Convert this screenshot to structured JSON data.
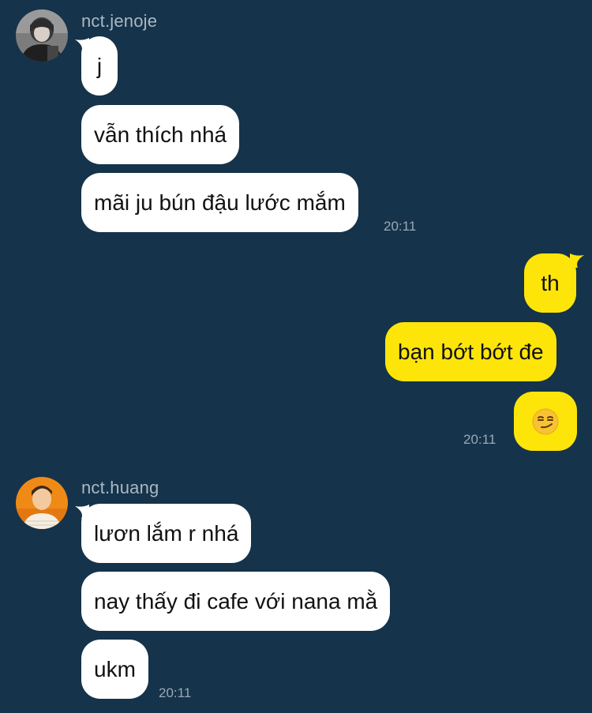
{
  "colors": {
    "background": "#15334a",
    "incoming_bubble": "#ffffff",
    "outgoing_bubble": "#fde50a",
    "meta_text": "#aab8c4"
  },
  "groups": [
    {
      "sender": "nct.jenoje",
      "avatar_icon": "profile-photo-dark-icon",
      "messages": [
        "j",
        "vẫn thích nhá",
        "mãi ju bún đậu lước mắm"
      ],
      "time": "20:11"
    },
    {
      "sender": "me",
      "messages": [
        "th",
        "bạn bớt bớt đe",
        "😏"
      ],
      "emoji_icon": "smirking-face-icon",
      "time": "20:11"
    },
    {
      "sender": "nct.huang",
      "avatar_icon": "profile-photo-orange-icon",
      "messages": [
        "lươn lắm r nhá",
        "nay thấy đi cafe với nana mằ",
        "ukm"
      ],
      "time": "20:11"
    }
  ]
}
